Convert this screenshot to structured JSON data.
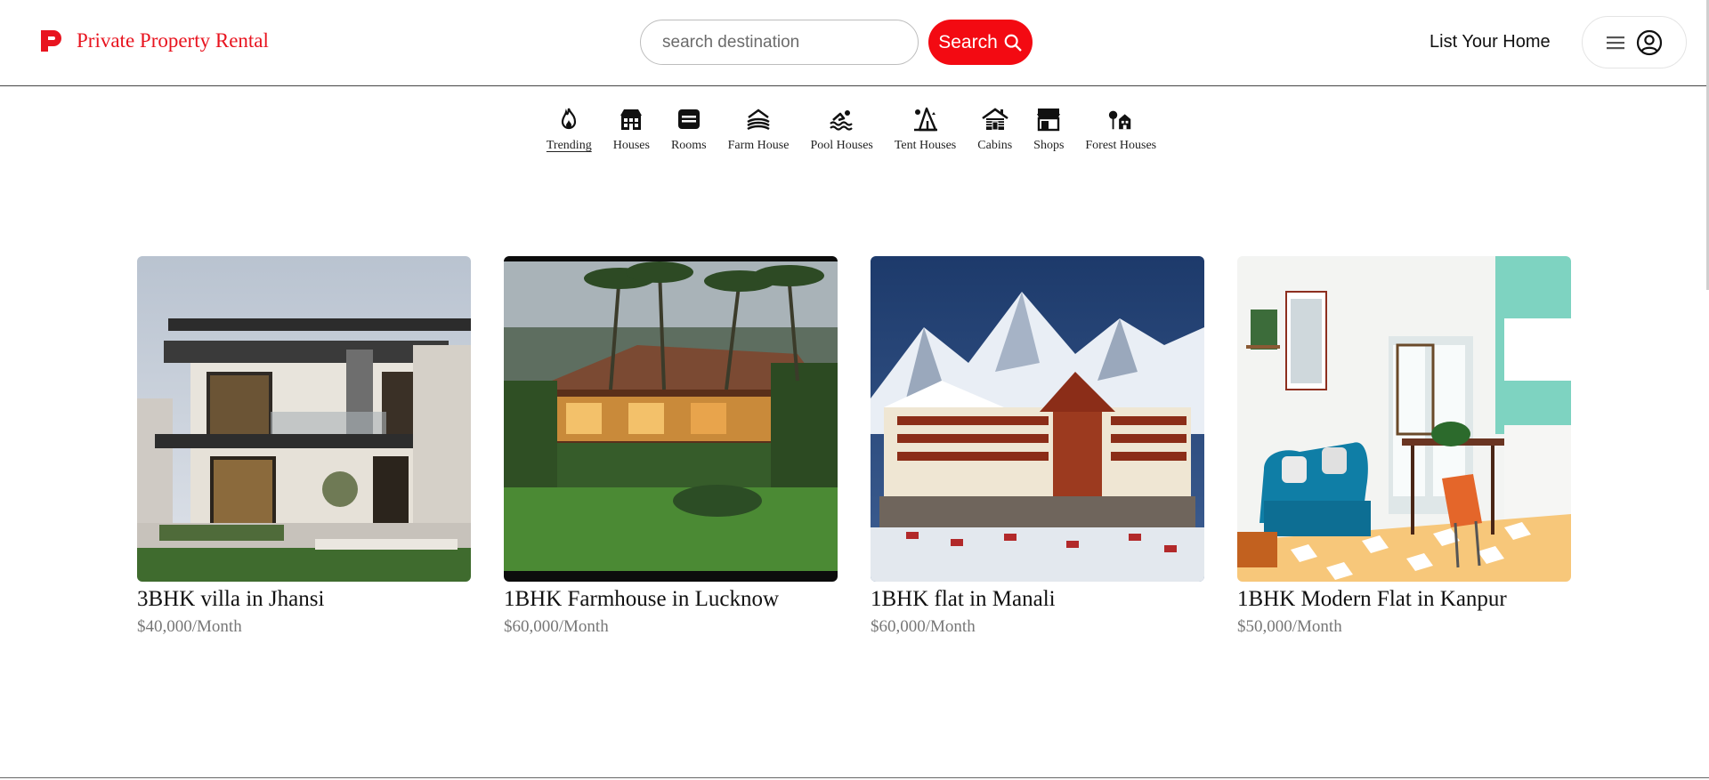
{
  "brand": {
    "name": "Private Property Rental",
    "color": "#e8141f"
  },
  "search": {
    "placeholder": "search destination",
    "button_label": "Search",
    "button_color": "#f30a12"
  },
  "header": {
    "list_home": "List Your Home"
  },
  "categories": [
    {
      "label": "Trending",
      "icon": "fire-icon",
      "active": true
    },
    {
      "label": "Houses",
      "icon": "house-icon"
    },
    {
      "label": "Rooms",
      "icon": "bed-icon"
    },
    {
      "label": "Farm House",
      "icon": "farm-house-icon"
    },
    {
      "label": "Pool Houses",
      "icon": "swimmer-icon"
    },
    {
      "label": "Tent Houses",
      "icon": "tent-icon"
    },
    {
      "label": "Cabins",
      "icon": "cabin-icon"
    },
    {
      "label": "Shops",
      "icon": "shop-icon"
    },
    {
      "label": "Forest Houses",
      "icon": "forest-house-icon"
    }
  ],
  "listings": [
    {
      "title": "3BHK villa in Jhansi",
      "price": "$40,000/Month",
      "image": "modern-villa-photo"
    },
    {
      "title": "1BHK Farmhouse in Lucknow",
      "price": "$60,000/Month",
      "image": "farmhouse-palms-photo"
    },
    {
      "title": "1BHK flat in Manali",
      "price": "$60,000/Month",
      "image": "snowy-mountain-hotel-photo"
    },
    {
      "title": "1BHK Modern Flat in Kanpur",
      "price": "$50,000/Month",
      "image": "modern-living-room-photo"
    }
  ]
}
